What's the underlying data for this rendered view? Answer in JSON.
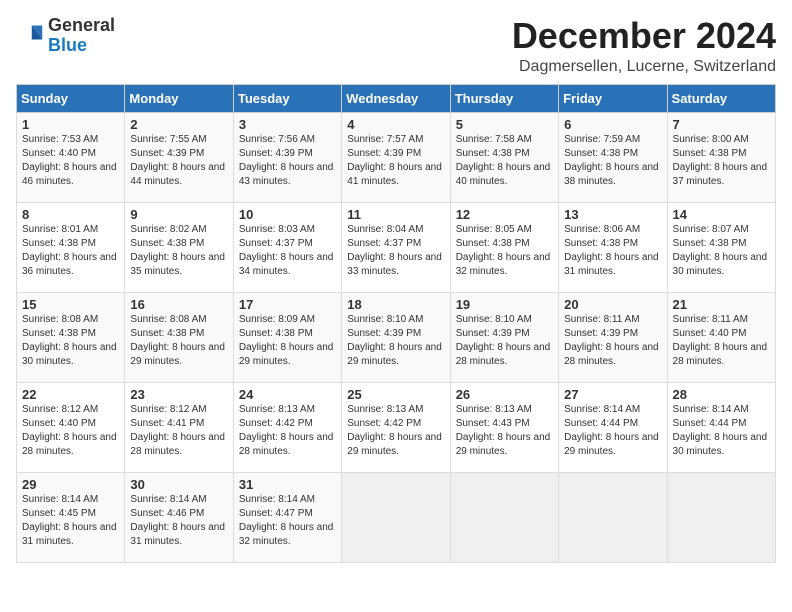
{
  "logo": {
    "general": "General",
    "blue": "Blue"
  },
  "title": "December 2024",
  "location": "Dagmersellen, Lucerne, Switzerland",
  "headers": [
    "Sunday",
    "Monday",
    "Tuesday",
    "Wednesday",
    "Thursday",
    "Friday",
    "Saturday"
  ],
  "weeks": [
    [
      {
        "day": "1",
        "sunrise": "7:53 AM",
        "sunset": "4:40 PM",
        "daylight": "8 hours and 46 minutes."
      },
      {
        "day": "2",
        "sunrise": "7:55 AM",
        "sunset": "4:39 PM",
        "daylight": "8 hours and 44 minutes."
      },
      {
        "day": "3",
        "sunrise": "7:56 AM",
        "sunset": "4:39 PM",
        "daylight": "8 hours and 43 minutes."
      },
      {
        "day": "4",
        "sunrise": "7:57 AM",
        "sunset": "4:39 PM",
        "daylight": "8 hours and 41 minutes."
      },
      {
        "day": "5",
        "sunrise": "7:58 AM",
        "sunset": "4:38 PM",
        "daylight": "8 hours and 40 minutes."
      },
      {
        "day": "6",
        "sunrise": "7:59 AM",
        "sunset": "4:38 PM",
        "daylight": "8 hours and 38 minutes."
      },
      {
        "day": "7",
        "sunrise": "8:00 AM",
        "sunset": "4:38 PM",
        "daylight": "8 hours and 37 minutes."
      }
    ],
    [
      {
        "day": "8",
        "sunrise": "8:01 AM",
        "sunset": "4:38 PM",
        "daylight": "8 hours and 36 minutes."
      },
      {
        "day": "9",
        "sunrise": "8:02 AM",
        "sunset": "4:38 PM",
        "daylight": "8 hours and 35 minutes."
      },
      {
        "day": "10",
        "sunrise": "8:03 AM",
        "sunset": "4:37 PM",
        "daylight": "8 hours and 34 minutes."
      },
      {
        "day": "11",
        "sunrise": "8:04 AM",
        "sunset": "4:37 PM",
        "daylight": "8 hours and 33 minutes."
      },
      {
        "day": "12",
        "sunrise": "8:05 AM",
        "sunset": "4:38 PM",
        "daylight": "8 hours and 32 minutes."
      },
      {
        "day": "13",
        "sunrise": "8:06 AM",
        "sunset": "4:38 PM",
        "daylight": "8 hours and 31 minutes."
      },
      {
        "day": "14",
        "sunrise": "8:07 AM",
        "sunset": "4:38 PM",
        "daylight": "8 hours and 30 minutes."
      }
    ],
    [
      {
        "day": "15",
        "sunrise": "8:08 AM",
        "sunset": "4:38 PM",
        "daylight": "8 hours and 30 minutes."
      },
      {
        "day": "16",
        "sunrise": "8:08 AM",
        "sunset": "4:38 PM",
        "daylight": "8 hours and 29 minutes."
      },
      {
        "day": "17",
        "sunrise": "8:09 AM",
        "sunset": "4:38 PM",
        "daylight": "8 hours and 29 minutes."
      },
      {
        "day": "18",
        "sunrise": "8:10 AM",
        "sunset": "4:39 PM",
        "daylight": "8 hours and 29 minutes."
      },
      {
        "day": "19",
        "sunrise": "8:10 AM",
        "sunset": "4:39 PM",
        "daylight": "8 hours and 28 minutes."
      },
      {
        "day": "20",
        "sunrise": "8:11 AM",
        "sunset": "4:39 PM",
        "daylight": "8 hours and 28 minutes."
      },
      {
        "day": "21",
        "sunrise": "8:11 AM",
        "sunset": "4:40 PM",
        "daylight": "8 hours and 28 minutes."
      }
    ],
    [
      {
        "day": "22",
        "sunrise": "8:12 AM",
        "sunset": "4:40 PM",
        "daylight": "8 hours and 28 minutes."
      },
      {
        "day": "23",
        "sunrise": "8:12 AM",
        "sunset": "4:41 PM",
        "daylight": "8 hours and 28 minutes."
      },
      {
        "day": "24",
        "sunrise": "8:13 AM",
        "sunset": "4:42 PM",
        "daylight": "8 hours and 28 minutes."
      },
      {
        "day": "25",
        "sunrise": "8:13 AM",
        "sunset": "4:42 PM",
        "daylight": "8 hours and 29 minutes."
      },
      {
        "day": "26",
        "sunrise": "8:13 AM",
        "sunset": "4:43 PM",
        "daylight": "8 hours and 29 minutes."
      },
      {
        "day": "27",
        "sunrise": "8:14 AM",
        "sunset": "4:44 PM",
        "daylight": "8 hours and 29 minutes."
      },
      {
        "day": "28",
        "sunrise": "8:14 AM",
        "sunset": "4:44 PM",
        "daylight": "8 hours and 30 minutes."
      }
    ],
    [
      {
        "day": "29",
        "sunrise": "8:14 AM",
        "sunset": "4:45 PM",
        "daylight": "8 hours and 31 minutes."
      },
      {
        "day": "30",
        "sunrise": "8:14 AM",
        "sunset": "4:46 PM",
        "daylight": "8 hours and 31 minutes."
      },
      {
        "day": "31",
        "sunrise": "8:14 AM",
        "sunset": "4:47 PM",
        "daylight": "8 hours and 32 minutes."
      },
      null,
      null,
      null,
      null
    ]
  ],
  "labels": {
    "sunrise": "Sunrise:",
    "sunset": "Sunset:",
    "daylight": "Daylight:"
  }
}
